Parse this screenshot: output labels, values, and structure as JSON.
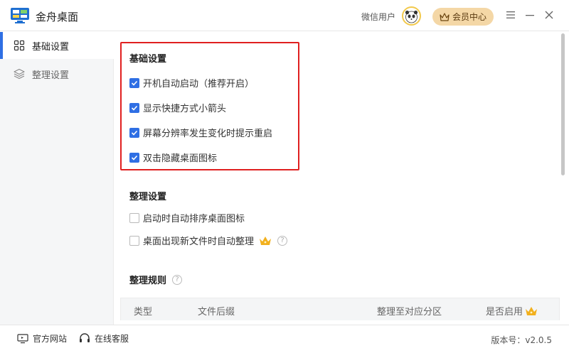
{
  "app": {
    "title": "金舟桌面"
  },
  "header": {
    "username": "微信用户",
    "vip_label": "会员中心",
    "icons": [
      "app-logo-icon",
      "avatar",
      "crown-icon",
      "menu-icon",
      "minimize-icon",
      "close-icon"
    ]
  },
  "sidebar": {
    "items": [
      {
        "label": "基础设置",
        "icon": "grid-icon",
        "active": true
      },
      {
        "label": "整理设置",
        "icon": "layers-icon",
        "active": false
      }
    ]
  },
  "basic_settings": {
    "title": "基础设置",
    "options": [
      {
        "label": "开机自动启动（推荐开启）",
        "checked": true
      },
      {
        "label": "显示快捷方式小箭头",
        "checked": true
      },
      {
        "label": "屏幕分辨率发生变化时提示重启",
        "checked": true
      },
      {
        "label": "双击隐藏桌面图标",
        "checked": true
      }
    ]
  },
  "organize_settings": {
    "title": "整理设置",
    "options": [
      {
        "label": "启动时自动排序桌面图标",
        "checked": false
      },
      {
        "label": "桌面出现新文件时自动整理",
        "checked": false
      }
    ]
  },
  "organize_rules": {
    "title": "整理规则",
    "columns": [
      "类型",
      "文件后缀",
      "整理至对应分区",
      "是否启用"
    ]
  },
  "footer": {
    "website_label": "官方网站",
    "service_label": "在线客服",
    "version_text": "版本号：v2.0.5"
  },
  "colors": {
    "accent": "#2f6fe4",
    "highlight": "#e02020",
    "vip": "#f4d7a6",
    "crown": "#f2b01e"
  }
}
